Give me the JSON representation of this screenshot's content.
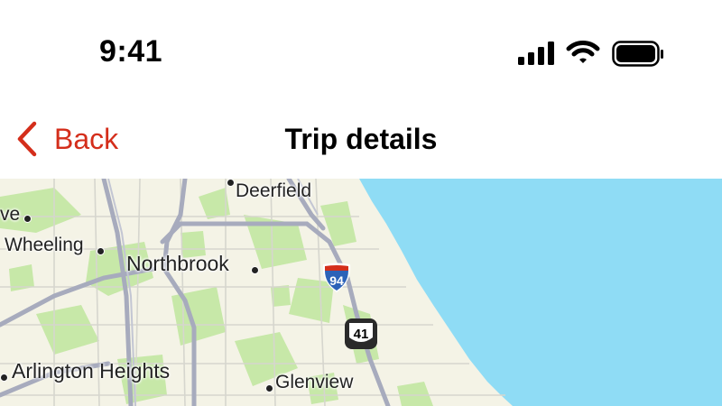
{
  "status_bar": {
    "time": "9:41",
    "icons": [
      "signal-icon",
      "wifi-icon",
      "battery-icon"
    ]
  },
  "nav": {
    "back_label": "Back",
    "title": "Trip details",
    "accent_color": "#d42e1b"
  },
  "map": {
    "water_color": "#8fdcf5",
    "land_color": "#f4f3e6",
    "park_color": "#c7e8a8",
    "places": {
      "deerfield": "Deerfield",
      "wheeling": "Wheeling",
      "northbrook": "Northbrook",
      "arlington_heights": "Arlington Heights",
      "glenview": "Glenview",
      "partial_left": "ve"
    },
    "shields": {
      "interstate": "94",
      "us_route": "41"
    }
  }
}
